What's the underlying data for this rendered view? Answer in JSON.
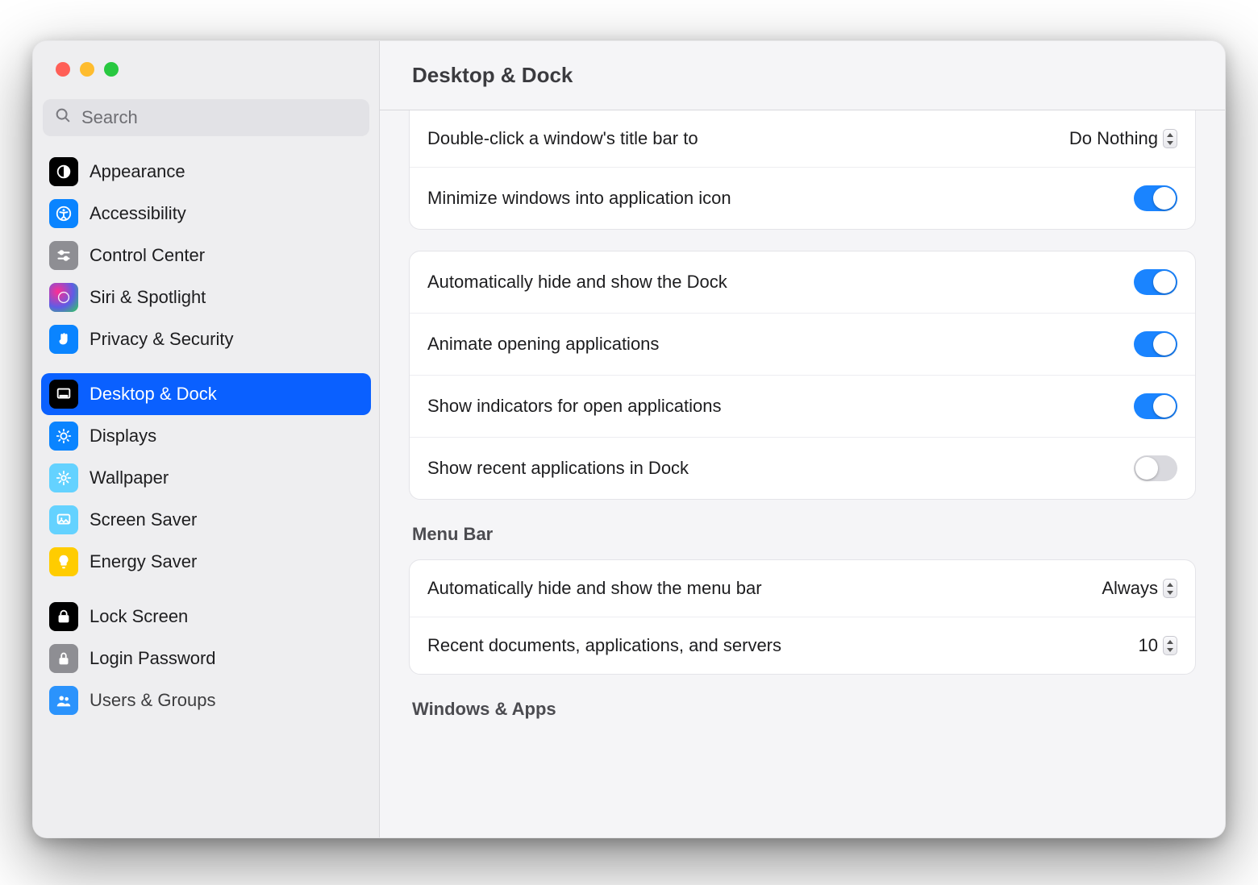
{
  "header": {
    "title": "Desktop & Dock"
  },
  "search": {
    "placeholder": "Search",
    "value": ""
  },
  "sidebar": {
    "groups": [
      {
        "items": [
          {
            "id": "appearance",
            "label": "Appearance"
          },
          {
            "id": "accessibility",
            "label": "Accessibility"
          },
          {
            "id": "controlcenter",
            "label": "Control Center"
          },
          {
            "id": "siri",
            "label": "Siri & Spotlight"
          },
          {
            "id": "privacy",
            "label": "Privacy & Security"
          }
        ]
      },
      {
        "items": [
          {
            "id": "desktopdock",
            "label": "Desktop & Dock",
            "selected": true
          },
          {
            "id": "displays",
            "label": "Displays"
          },
          {
            "id": "wallpaper",
            "label": "Wallpaper"
          },
          {
            "id": "screensaver",
            "label": "Screen Saver"
          },
          {
            "id": "energy",
            "label": "Energy Saver"
          }
        ]
      },
      {
        "items": [
          {
            "id": "lock",
            "label": "Lock Screen"
          },
          {
            "id": "login",
            "label": "Login Password"
          },
          {
            "id": "users",
            "label": "Users & Groups"
          }
        ]
      }
    ]
  },
  "panel": {
    "group_dock": {
      "double_click_title": {
        "label": "Double-click a window's title bar to",
        "value": "Do Nothing"
      },
      "minimize_into_icon": {
        "label": "Minimize windows into application icon",
        "on": true
      }
    },
    "group_dock2": {
      "auto_hide_dock": {
        "label": "Automatically hide and show the Dock",
        "on": true
      },
      "animate_open": {
        "label": "Animate opening applications",
        "on": true
      },
      "show_indicators": {
        "label": "Show indicators for open applications",
        "on": true
      },
      "show_recent": {
        "label": "Show recent applications in Dock",
        "on": false
      }
    },
    "section_menubar_heading": "Menu Bar",
    "group_menubar": {
      "auto_hide_menubar": {
        "label": "Automatically hide and show the menu bar",
        "value": "Always"
      },
      "recent_items": {
        "label": "Recent documents, applications, and servers",
        "value": "10"
      }
    },
    "section_windows_heading": "Windows & Apps"
  }
}
